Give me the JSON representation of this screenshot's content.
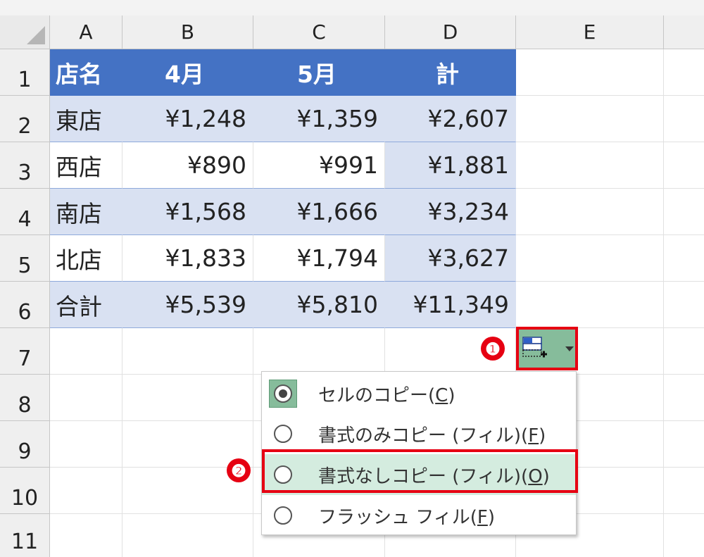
{
  "columns": [
    "A",
    "B",
    "C",
    "D",
    "E"
  ],
  "rows": [
    "1",
    "2",
    "3",
    "4",
    "5",
    "6",
    "7",
    "8",
    "9",
    "10",
    "11"
  ],
  "table": {
    "header": [
      "店名",
      "4月",
      "5月",
      "計"
    ],
    "data": [
      [
        "東店",
        "¥1,248",
        "¥1,359",
        "¥2,607"
      ],
      [
        "西店",
        "¥890",
        "¥991",
        "¥1,881"
      ],
      [
        "南店",
        "¥1,568",
        "¥1,666",
        "¥3,234"
      ],
      [
        "北店",
        "¥1,833",
        "¥1,794",
        "¥3,627"
      ],
      [
        "合計",
        "¥5,539",
        "¥5,810",
        "¥11,349"
      ]
    ]
  },
  "badges": {
    "one": "❶",
    "two": "❷"
  },
  "autofill_menu": {
    "items": [
      {
        "text": "セルのコピー(",
        "key": "C",
        "tail": ")"
      },
      {
        "text": "書式のみコピー (フィル)(",
        "key": "F",
        "tail": ")"
      },
      {
        "text": "書式なしコピー (フィル)(",
        "key": "O",
        "tail": ")"
      },
      {
        "text": "フラッシュ フィル(",
        "key": "F",
        "tail": ")"
      }
    ]
  },
  "colors": {
    "header_fill": "#4472c4",
    "band_fill": "#d9e1f2",
    "highlight_red": "#e60012",
    "option_green": "#86bc9b",
    "menu_hover": "#d4ecdf"
  },
  "icons": {
    "autofill_options": "autofill-options-icon",
    "dropdown": "chevron-down-icon"
  }
}
